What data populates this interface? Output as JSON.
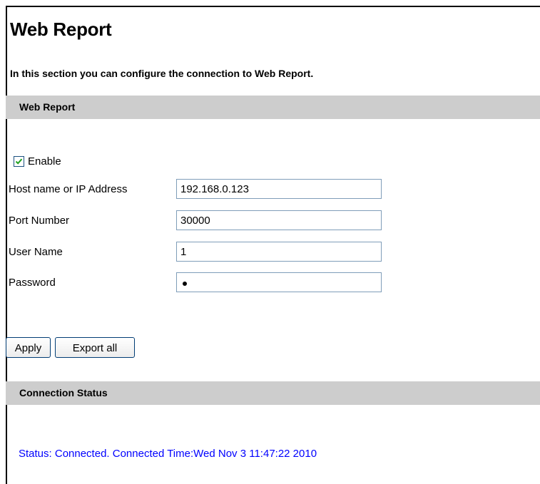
{
  "page": {
    "title": "Web Report",
    "intro": "In this section you can configure the connection to Web Report."
  },
  "web_report_section": {
    "heading": "Web Report",
    "enable": {
      "label": "Enable",
      "checked": true
    },
    "fields": [
      {
        "label": "Host name or IP Address",
        "value": "192.168.0.123"
      },
      {
        "label": "Port Number",
        "value": "30000"
      },
      {
        "label": "User Name",
        "value": "1"
      },
      {
        "label": "Password",
        "value": "•",
        "masked": true
      }
    ]
  },
  "buttons": {
    "apply": "Apply",
    "export_all": "Export all"
  },
  "connection_status_section": {
    "heading": "Connection Status",
    "status_text": "Status: Connected. Connected Time:Wed Nov 3 11:47:22 2010",
    "status_color": "#0000ff"
  },
  "colors": {
    "section_bar": "#cdcdcd",
    "checkbox_check": "#21a121"
  }
}
